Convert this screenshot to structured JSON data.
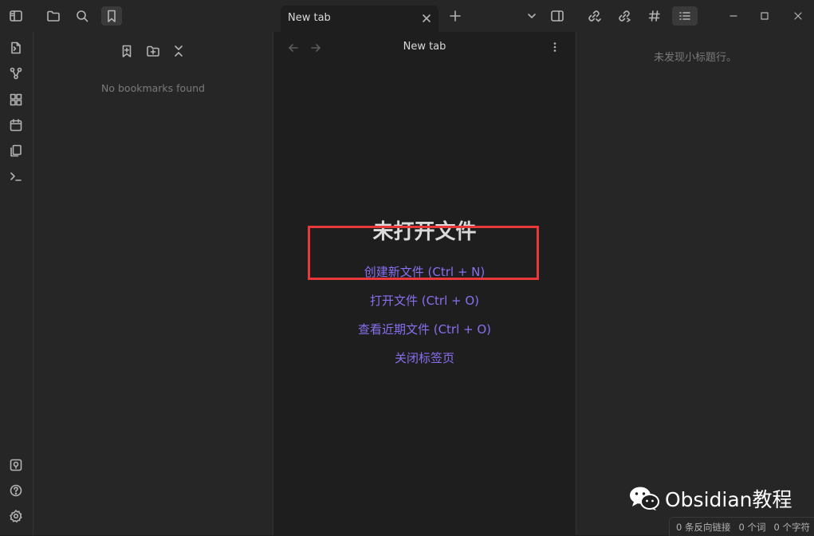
{
  "tab": {
    "title": "New tab",
    "close": "×"
  },
  "left_sidebar": {
    "empty_message": "No bookmarks found"
  },
  "main": {
    "view_title": "New tab",
    "empty_title": "未打开文件",
    "actions": [
      "创建新文件 (Ctrl + N)",
      "打开文件 (Ctrl + O)",
      "查看近期文件 (Ctrl + O)",
      "关闭标签页"
    ]
  },
  "right_sidebar": {
    "empty_message": "未发现小标题行。"
  },
  "statusbar": {
    "backlinks": "0 条反向链接",
    "words": "0 个词",
    "chars": "0 个字符"
  },
  "watermark": {
    "text": "Obsidian教程"
  },
  "colors": {
    "accent": "#8a6ff0",
    "highlight_box": "#e8393a",
    "background": "#1e1e1e",
    "sidebar": "#262626"
  },
  "icons": {
    "ribbon_top": [
      "open-quick-switcher-icon",
      "graph-view-icon",
      "canvas-icon",
      "daily-note-icon",
      "templates-icon",
      "command-palette-icon"
    ],
    "ribbon_bottom": [
      "vault-switcher-icon",
      "help-icon",
      "settings-icon"
    ]
  }
}
